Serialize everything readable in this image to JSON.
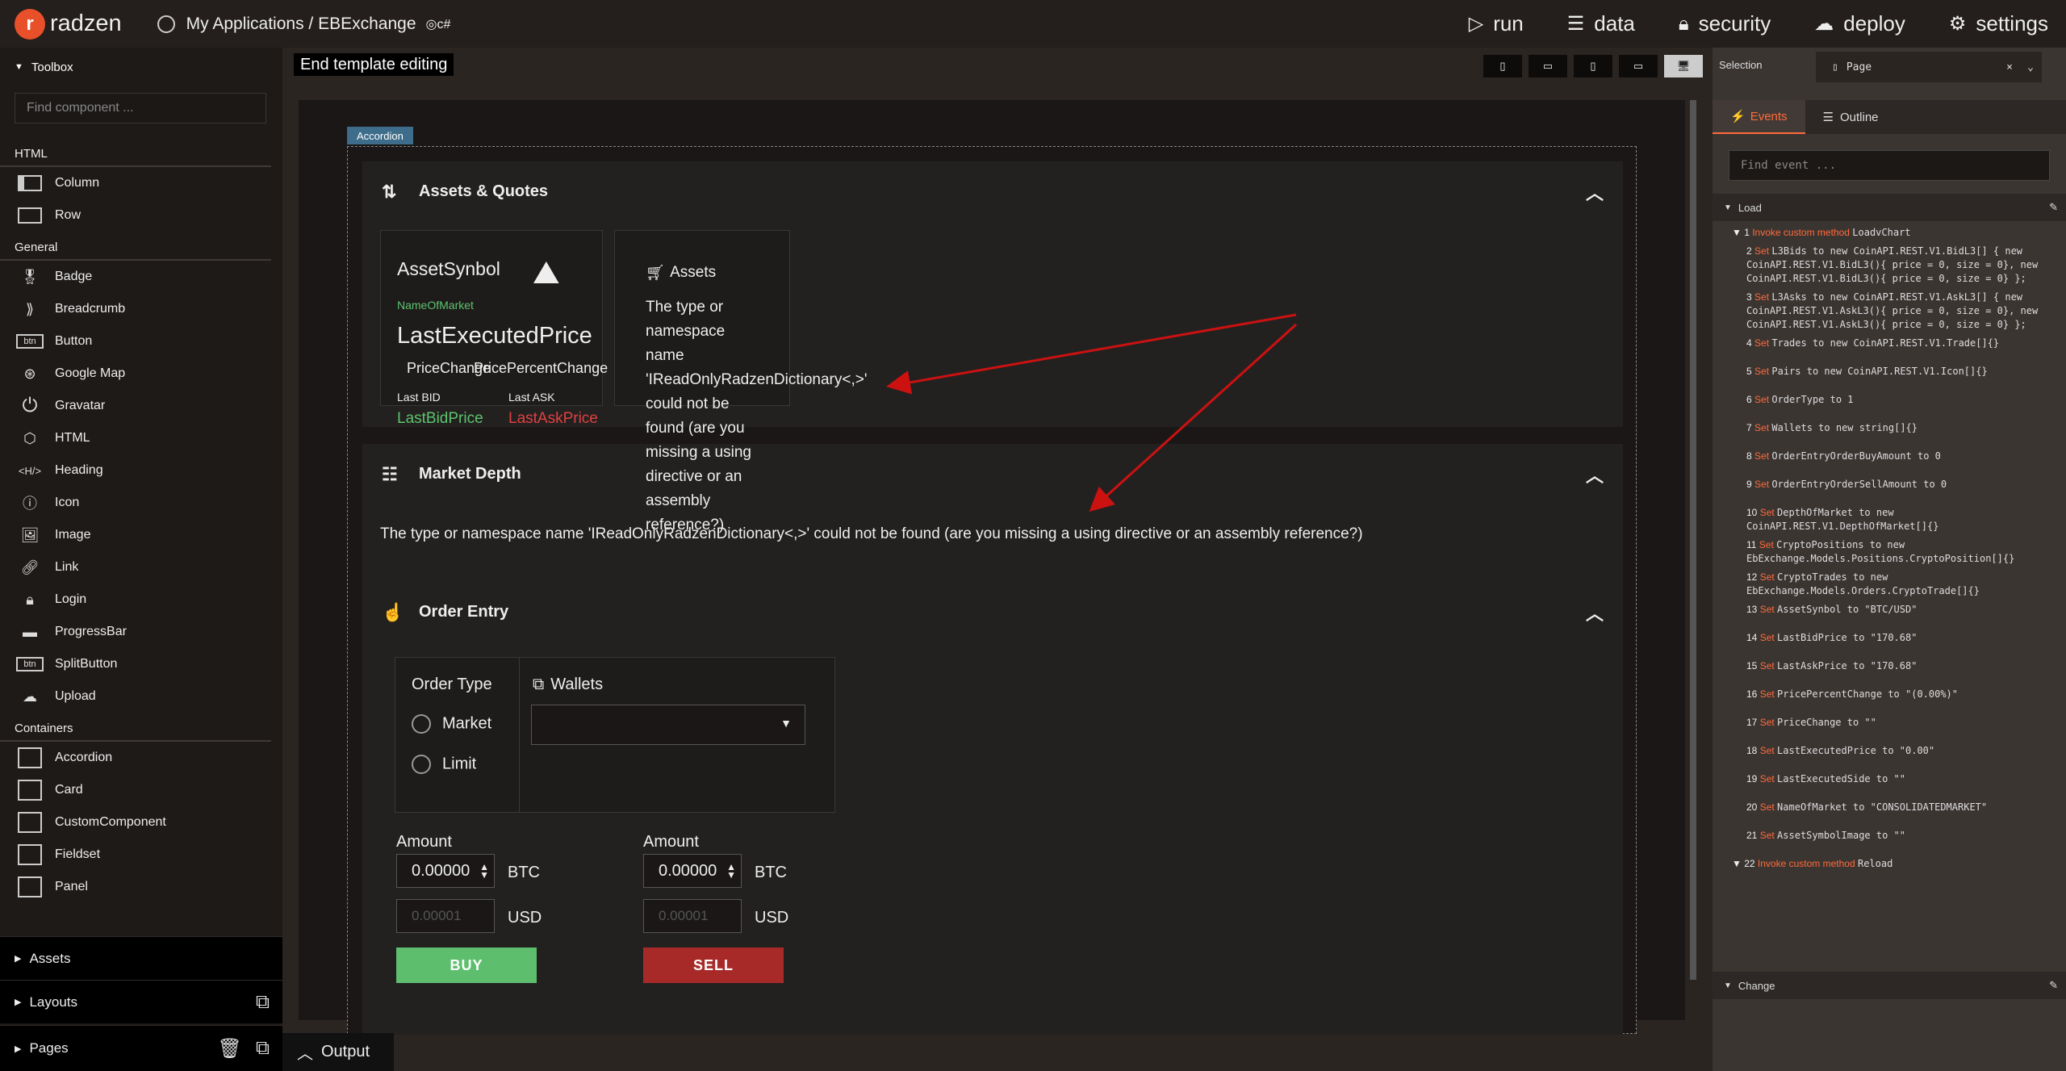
{
  "topbar": {
    "logo": "radzen",
    "breadcrumb": "My Applications / EBExchange",
    "menu": [
      "run",
      "data",
      "security",
      "deploy",
      "settings"
    ]
  },
  "toolbox": {
    "title": "Toolbox",
    "search_placeholder": "Find component ...",
    "groups": {
      "html": "HTML",
      "general": "General",
      "containers": "Containers"
    },
    "html_items": [
      "Column",
      "Row"
    ],
    "general_items": [
      "Badge",
      "Breadcrumb",
      "Button",
      "Google Map",
      "Gravatar",
      "HTML",
      "Heading",
      "Icon",
      "Image",
      "Link",
      "Login",
      "ProgressBar",
      "SplitButton",
      "Upload"
    ],
    "container_items": [
      "Accordion",
      "Card",
      "CustomComponent",
      "Fieldset",
      "Panel"
    ],
    "bottom": [
      "Assets",
      "Layouts",
      "Pages"
    ]
  },
  "editor": {
    "end_label": "End template editing",
    "tag": "Accordion",
    "output": "Output"
  },
  "accordion": {
    "assets_title": "Assets & Quotes",
    "asset_symbol": "AssetSynbol",
    "name_of_market": "NameOfMarket",
    "last_price": "LastExecutedPrice",
    "price_change": "PriceChange",
    "price_pct": "PricePercentChange",
    "last_bid_label": "Last BID",
    "last_ask_label": "Last ASK",
    "last_bid": "LastBidPrice",
    "last_ask": "LastAskPrice",
    "assets_card_title": "Assets",
    "error_card": "The type or namespace name 'IReadOnlyRadzenDictionary<,>' could not be found (are you missing a using directive or an assembly reference?)",
    "market_depth_title": "Market Depth",
    "error_wide": "The type or namespace name 'IReadOnlyRadzenDictionary<,>' could not be found (are you missing a using directive or an assembly reference?)",
    "order_entry_title": "Order Entry",
    "order_type": "Order Type",
    "market": "Market",
    "limit": "Limit",
    "wallets": "Wallets",
    "amount": "Amount",
    "amount_value": "0.00000",
    "limit_placeholder": "0.00001",
    "btc": "BTC",
    "usd": "USD",
    "buy": "BUY",
    "sell": "SELL"
  },
  "right": {
    "selection": "Selection",
    "page": "Page",
    "tab_events": "Events",
    "tab_outline": "Outline",
    "search_placeholder": "Find event ...",
    "load": "Load",
    "change": "Change",
    "events": [
      [
        "1",
        "Invoke custom method",
        "LoadvChart"
      ],
      [
        "2",
        "Set",
        "L3Bids  to new CoinAPI.REST.V1.BidL3[] { new CoinAPI.REST.V1.BidL3(){ price = 0, size = 0}, new CoinAPI.REST.V1.BidL3(){ price = 0, size = 0} };"
      ],
      [
        "3",
        "Set",
        "L3Asks  to new CoinAPI.REST.V1.AskL3[] { new CoinAPI.REST.V1.AskL3(){ price = 0, size = 0}, new CoinAPI.REST.V1.AskL3(){ price = 0, size = 0} };"
      ],
      [
        "4",
        "Set",
        "Trades  to new CoinAPI.REST.V1.Trade[]{}"
      ],
      [
        "5",
        "Set",
        "Pairs  to new CoinAPI.REST.V1.Icon[]{}"
      ],
      [
        "6",
        "Set",
        "OrderType  to 1"
      ],
      [
        "7",
        "Set",
        "Wallets  to new string[]{}"
      ],
      [
        "8",
        "Set",
        "OrderEntryOrderBuyAmount  to 0"
      ],
      [
        "9",
        "Set",
        "OrderEntryOrderSellAmount  to 0"
      ],
      [
        "10",
        "Set",
        "DepthOfMarket  to new CoinAPI.REST.V1.DepthOfMarket[]{}"
      ],
      [
        "11",
        "Set",
        "CryptoPositions  to new EbExchange.Models.Positions.CryptoPosition[]{}"
      ],
      [
        "12",
        "Set",
        "CryptoTrades  to new EbExchange.Models.Orders.CryptoTrade[]{}"
      ],
      [
        "13",
        "Set",
        "AssetSynbol  to \"BTC/USD\""
      ],
      [
        "14",
        "Set",
        "LastBidPrice  to \"170.68\""
      ],
      [
        "15",
        "Set",
        "LastAskPrice  to \"170.68\""
      ],
      [
        "16",
        "Set",
        "PricePercentChange  to \"(0.00%)\""
      ],
      [
        "17",
        "Set",
        "PriceChange  to \"\""
      ],
      [
        "18",
        "Set",
        "LastExecutedPrice  to \"0.00\""
      ],
      [
        "19",
        "Set",
        "LastExecutedSide  to \"\""
      ],
      [
        "20",
        "Set",
        "NameOfMarket  to \"CONSOLIDATEDMARKET\""
      ],
      [
        "21",
        "Set",
        "AssetSymbolImage  to \"\""
      ],
      [
        "22",
        "Invoke custom method",
        "Reload"
      ]
    ]
  }
}
